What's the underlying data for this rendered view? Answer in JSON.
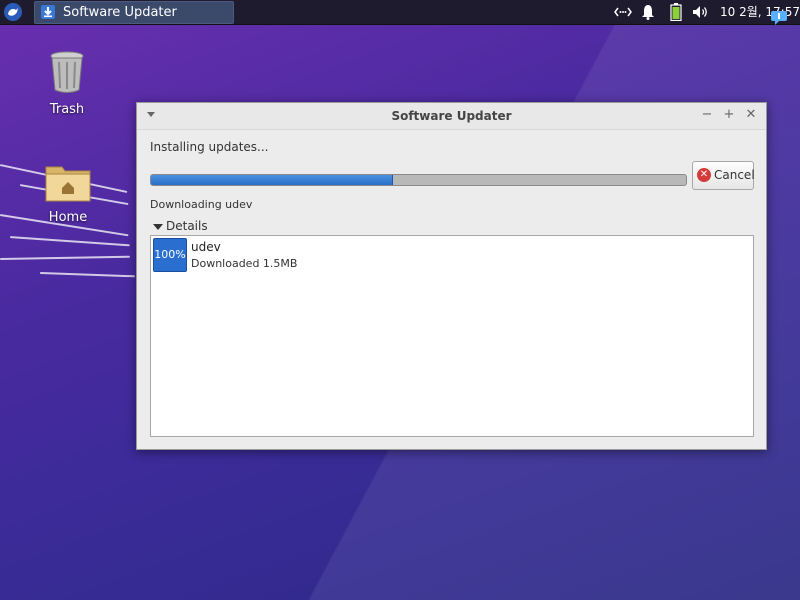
{
  "panel": {
    "task_title": "Software Updater",
    "clock": "10 2월, 17:57"
  },
  "desktop": {
    "icons": [
      {
        "label": "Trash"
      },
      {
        "label": "Home"
      }
    ]
  },
  "window": {
    "title": "Software Updater",
    "status": "Installing updates...",
    "progress": 0.45,
    "cancel_label": "Cancel",
    "current_action": "Downloading udev",
    "details_label": "Details",
    "packages": [
      {
        "percent": "100%",
        "name": "udev",
        "status": "Downloaded 1.5MB"
      }
    ]
  },
  "colors": {
    "accent": "#2a6fd0",
    "panel_bg": "#1f1b2e",
    "task_button_bg": "#3b4a6a"
  }
}
